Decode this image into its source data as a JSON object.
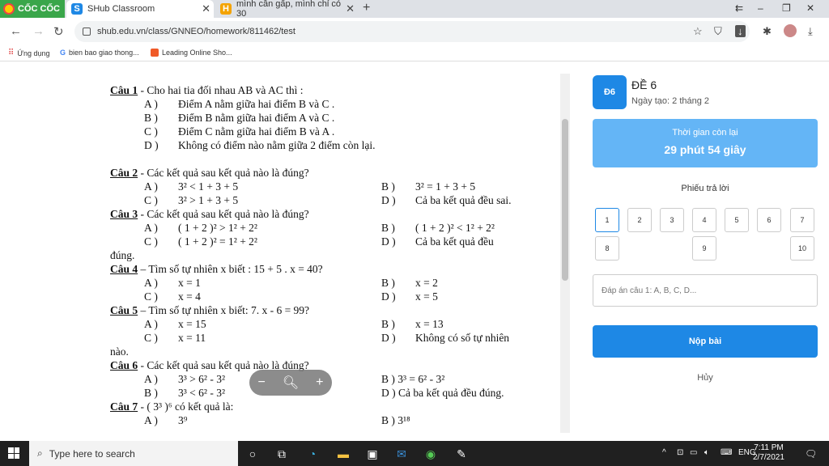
{
  "browser": {
    "brand": "CỐC CỐC",
    "tabs": [
      {
        "label": "SHub Classroom"
      },
      {
        "label": "mình cần gấp, mình chỉ có 30"
      }
    ],
    "url": "shub.edu.vn/class/GNNEO/homework/811462/test",
    "bookmarks": [
      {
        "label": "Ứng dụng"
      },
      {
        "label": "bien bao giao thong..."
      },
      {
        "label": "Leading Online Sho..."
      }
    ]
  },
  "paper": {
    "lines": [
      {
        "q": "Câu 1",
        "text": " - Cho hai tia đối nhau AB và AC thì :"
      },
      {
        "a": "A )",
        "at": "Điểm A nằm giữa hai điểm B và C ."
      },
      {
        "a": "B )",
        "at": "Điểm B nằm giữa hai điểm A và C ."
      },
      {
        "a": "C )",
        "at": "Điểm C nằm giữa hai điểm B và A ."
      },
      {
        "a": "D )",
        "at": "Không có điểm nào nằm giữa 2 điểm còn lại."
      },
      {
        "blank": true
      },
      {
        "q": "Câu 2",
        "text": " - Các kết quả sau kết quả nào là đúng?"
      },
      {
        "a": "A )",
        "at": "3² < 1 + 3 + 5",
        "b": "B )",
        "bt": "3² = 1 + 3 + 5"
      },
      {
        "a": "C )",
        "at": "3² > 1 + 3 + 5",
        "b": "D )",
        "bt": "Cả ba kết quả đều sai."
      },
      {
        "q": "Câu 3",
        "text": " -  Các kết quả sau kết quả nào là đúng?"
      },
      {
        "a": "A )",
        "at": "( 1 + 2 )² > 1² + 2²",
        "b": "B )",
        "bt": "( 1 + 2 )² < 1² + 2²"
      },
      {
        "a": "C )",
        "at": "( 1 + 2 )² = 1² + 2²",
        "b": "D )",
        "bt": "Cả ba kết quả đều"
      },
      {
        "plain": "đúng."
      },
      {
        "q": "Câu 4",
        "text": " –   Tìm số tự nhiên x biết : 15 + 5 . x = 40?"
      },
      {
        "a": "A )",
        "at": "x = 1",
        "b": "B )",
        "bt": "x = 2"
      },
      {
        "a": "C )",
        "at": "x = 4",
        "b": "D )",
        "bt": "x = 5"
      },
      {
        "q": "Câu 5",
        "text": " –   Tìm số tự nhiên x biết: 7. x - 6 = 99?"
      },
      {
        "a": "A )",
        "at": "x = 15",
        "b": "B )",
        "bt": "x = 13"
      },
      {
        "a": "C )",
        "at": "x = 11",
        "b": "D )",
        "bt": "Không có số tự nhiên"
      },
      {
        "plain": "nào."
      },
      {
        "q": "Câu 6",
        "text": " - Các kết quả sau kết quả nào là đúng?"
      },
      {
        "a": "A )",
        "at": "3³ > 6² - 3²",
        "b": "B ) 3³ = 6² - 3²",
        "bt": ""
      },
      {
        "a": "B )",
        "at": "3³ < 6² - 3²",
        "b": "D ) Cả ba kết quả đều đúng.",
        "bt": ""
      },
      {
        "q": "Câu 7",
        "text": " -  ( 3³ )⁶ có kết quả là:"
      },
      {
        "a": "A )",
        "at": "3⁹",
        "b": "B ) 3¹⁸",
        "bt": ""
      }
    ]
  },
  "sidebar": {
    "badge": "Đ6",
    "title": "ĐỀ 6",
    "date": "Ngày tạo: 2 tháng 2",
    "timer_label": "Thời gian còn lại",
    "timer_value": "29 phút 54 giây",
    "sheet_title": "Phiếu trả lời",
    "answers": [
      "1",
      "2",
      "3",
      "4",
      "5",
      "6",
      "7",
      "8",
      "9",
      "10"
    ],
    "input_placeholder": "Đáp án câu 1: A, B, C, D...",
    "submit_label": "Nộp bài",
    "cancel_label": "Hủy"
  },
  "taskbar": {
    "search_placeholder": "Type here to search",
    "lang": "ENG",
    "time": "7:11 PM",
    "date": "2/7/2021"
  }
}
